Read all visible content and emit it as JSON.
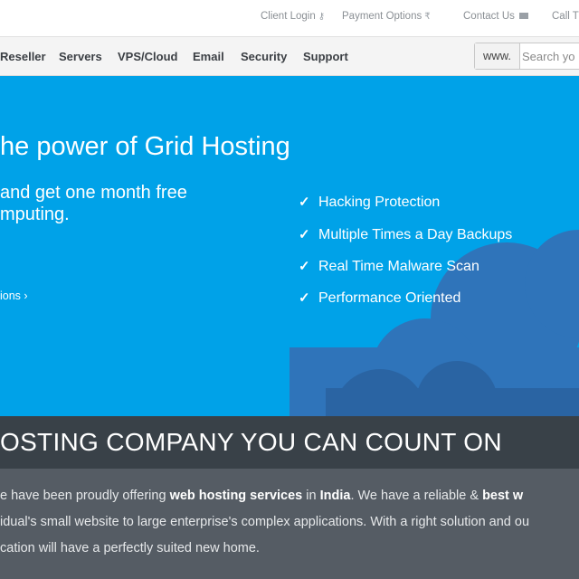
{
  "topbar": {
    "client_login": "Client Login",
    "payment_options": "Payment Options",
    "contact_us": "Contact Us",
    "call": "Call T"
  },
  "nav": {
    "items": [
      "Reseller",
      "Servers",
      "VPS/Cloud",
      "Email",
      "Security",
      "Support"
    ]
  },
  "search": {
    "prefix": "www.",
    "placeholder": "Search yo"
  },
  "hero": {
    "title": "he power of Grid Hosting",
    "subtitle_line1": "and get one month free",
    "subtitle_line2": "mputing.",
    "link": "ions ›",
    "features": [
      "Hacking Protection",
      "Multiple Times a Day Backups",
      "Real Time Malware Scan",
      "Performance Oriented"
    ],
    "check": "✓"
  },
  "band": {
    "title": "OSTING COMPANY YOU CAN COUNT ON"
  },
  "copy": {
    "l1_a": "e have been proudly offering ",
    "l1_b": "web hosting services",
    "l1_c": " in ",
    "l1_d": "India",
    "l1_e": ". We have a reliable & ",
    "l1_f": "best w",
    "l2": "idual's small website to large enterprise's complex applications. With a right solution and ou",
    "l3": "cation will have a perfectly suited new home."
  },
  "colors": {
    "hero_bg": "#00a2e8",
    "cloud_dark": "#2b6cb0",
    "cloud_mid": "#3a7fc4",
    "band_bg": "#394148",
    "copy_bg": "#555c64"
  }
}
